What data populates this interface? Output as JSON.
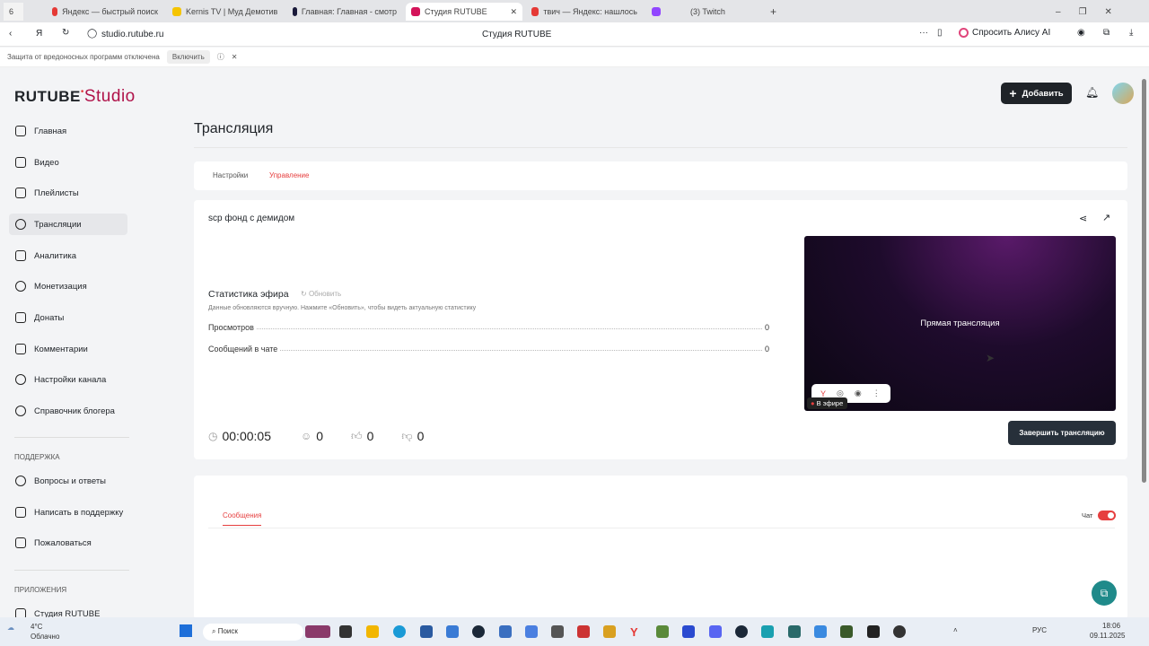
{
  "browser": {
    "tab_count": "6",
    "tabs": [
      {
        "title": "Яндекс — быстрый поиск",
        "color": "#e53935"
      },
      {
        "title": "Kernis TV | Муд Демотив",
        "color": "#f5c400"
      },
      {
        "title": "Главная: Главная - смотр",
        "color": "#1a1a3a"
      },
      {
        "title": "Студия RUTUBE",
        "color": "#d4145a",
        "active": true
      },
      {
        "title": "твич — Яндекс: нашлось",
        "color": "#e53935"
      },
      {
        "title": "(3) Twitch",
        "color": "#9146ff"
      }
    ],
    "url": "studio.rutube.ru",
    "page_title": "Студия RUTUBE",
    "alice": "Спросить Алису AI",
    "warning": "Защита от вредоносных программ отключена",
    "warning_button": "Включить"
  },
  "header": {
    "logo": "RUTUBE",
    "logo_suffix": "Studio",
    "add_button": "Добавить"
  },
  "sidebar": {
    "items": [
      {
        "label": "Главная",
        "icon": "home-icon"
      },
      {
        "label": "Видео",
        "icon": "video-icon"
      },
      {
        "label": "Плейлисты",
        "icon": "playlist-icon"
      },
      {
        "label": "Трансляции",
        "icon": "broadcast-icon",
        "active": true
      },
      {
        "label": "Аналитика",
        "icon": "chart-icon"
      },
      {
        "label": "Монетизация",
        "icon": "money-icon"
      },
      {
        "label": "Донаты",
        "icon": "donate-icon"
      },
      {
        "label": "Комментарии",
        "icon": "comment-icon"
      },
      {
        "label": "Настройки канала",
        "icon": "gear-icon"
      },
      {
        "label": "Справочник блогера",
        "icon": "book-icon"
      }
    ],
    "support_title": "ПОДДЕРЖКА",
    "support": [
      {
        "label": "Вопросы и ответы"
      },
      {
        "label": "Написать в поддержку"
      },
      {
        "label": "Пожаловаться"
      }
    ],
    "apps_title": "ПРИЛОЖЕНИЯ",
    "apps": [
      {
        "label": "Студия RUTUBE"
      }
    ]
  },
  "main": {
    "title": "Трансляция",
    "tabs": [
      "Настройки",
      "Управление"
    ],
    "active_tab": 1,
    "stream_name": "scp фонд с демидом",
    "stats_title": "Статистика эфира",
    "refresh": "Обновить",
    "stats_note": "Данные обновляются вручную. Нажмите «Обновить», чтобы видеть актуальную статистику",
    "stats": [
      {
        "label": "Просмотров",
        "value": "0"
      },
      {
        "label": "Сообщений в чате",
        "value": "0"
      }
    ],
    "timer": "00:00:05",
    "viewers": "0",
    "likes": "0",
    "dislikes": "0",
    "player_label": "Прямая трансляция",
    "live_badge": "В эфире",
    "end_button": "Завершить трансляцию",
    "messages_tab": "Сообщения",
    "chat_label": "Чат",
    "chat_enabled": true,
    "accent": "#e63f3f"
  },
  "taskbar": {
    "weather_temp": "4°C",
    "weather": "Облачно",
    "search": "Поиск",
    "lang": "РУС",
    "time": "18:06",
    "date": "09.11.2025"
  }
}
